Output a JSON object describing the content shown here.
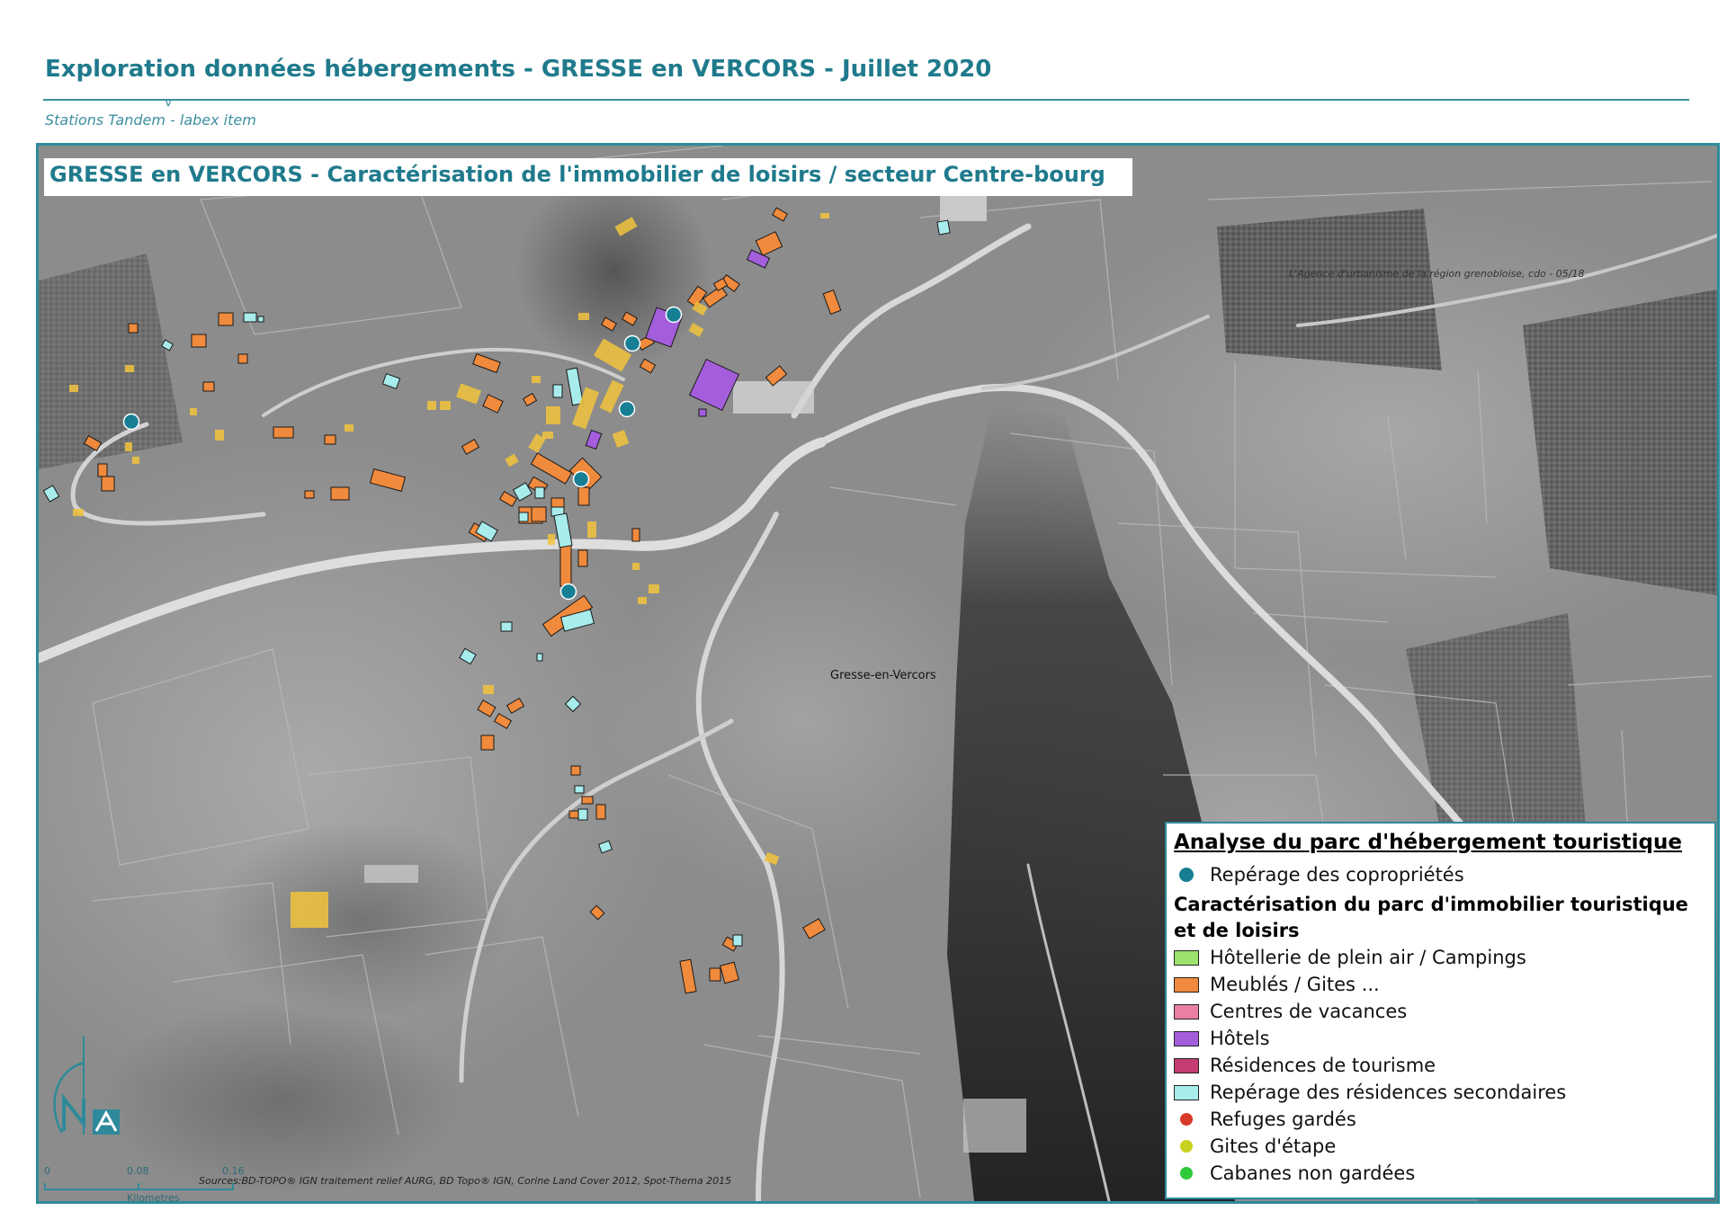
{
  "header": {
    "title": "Exploration données hébergements - GRESSE en VERCORS - Juillet 2020",
    "subtitle": "Stations Tandem - labex item"
  },
  "map": {
    "title": "GRESSE en VERCORS - Caractérisation de l'immobilier de loisirs / secteur Centre-bourg",
    "town_label": "Gresse-en-Vercors",
    "credit": "L'Agence d'urbanisme de la région grenobloise, cdo - 05/18",
    "sources": "Sources:BD-TOPO® IGN traitement relief AURG, BD Topo® IGN, Corine Land Cover 2012, Spot-Thema 2015",
    "scale": {
      "ticks": [
        "0",
        "0.08",
        "0.16"
      ],
      "unit": "Kilometres"
    }
  },
  "legend": {
    "title": "Analyse du parc d'hébergement touristique",
    "point_item": {
      "label": "Repérage des copropriétés",
      "color": "#167f94"
    },
    "heading": "Caractérisation du parc d'immobilier touristique et de loisirs",
    "area_items": [
      {
        "label": "Hôtellerie de plein air / Campings",
        "color": "#9be36d"
      },
      {
        "label": "Meublés / Gites ...",
        "color": "#f08a3c"
      },
      {
        "label": "Centres de vacances",
        "color": "#e97fa3"
      },
      {
        "label": "Hôtels",
        "color": "#a45ddb"
      },
      {
        "label": "Résidences de tourisme",
        "color": "#c43d72"
      },
      {
        "label": "Repérage des résidences secondaires",
        "color": "#a8ecec"
      }
    ],
    "dot_items": [
      {
        "label": "Refuges gardés",
        "color": "#d83a2a"
      },
      {
        "label": "Gites d'étape",
        "color": "#c8d21e"
      },
      {
        "label": "Cabanes non gardées",
        "color": "#2fc93a"
      }
    ]
  },
  "colors": {
    "accent": "#1f7a8c",
    "frame": "#2e8a9a",
    "building_yellow": "#f2c33c"
  }
}
